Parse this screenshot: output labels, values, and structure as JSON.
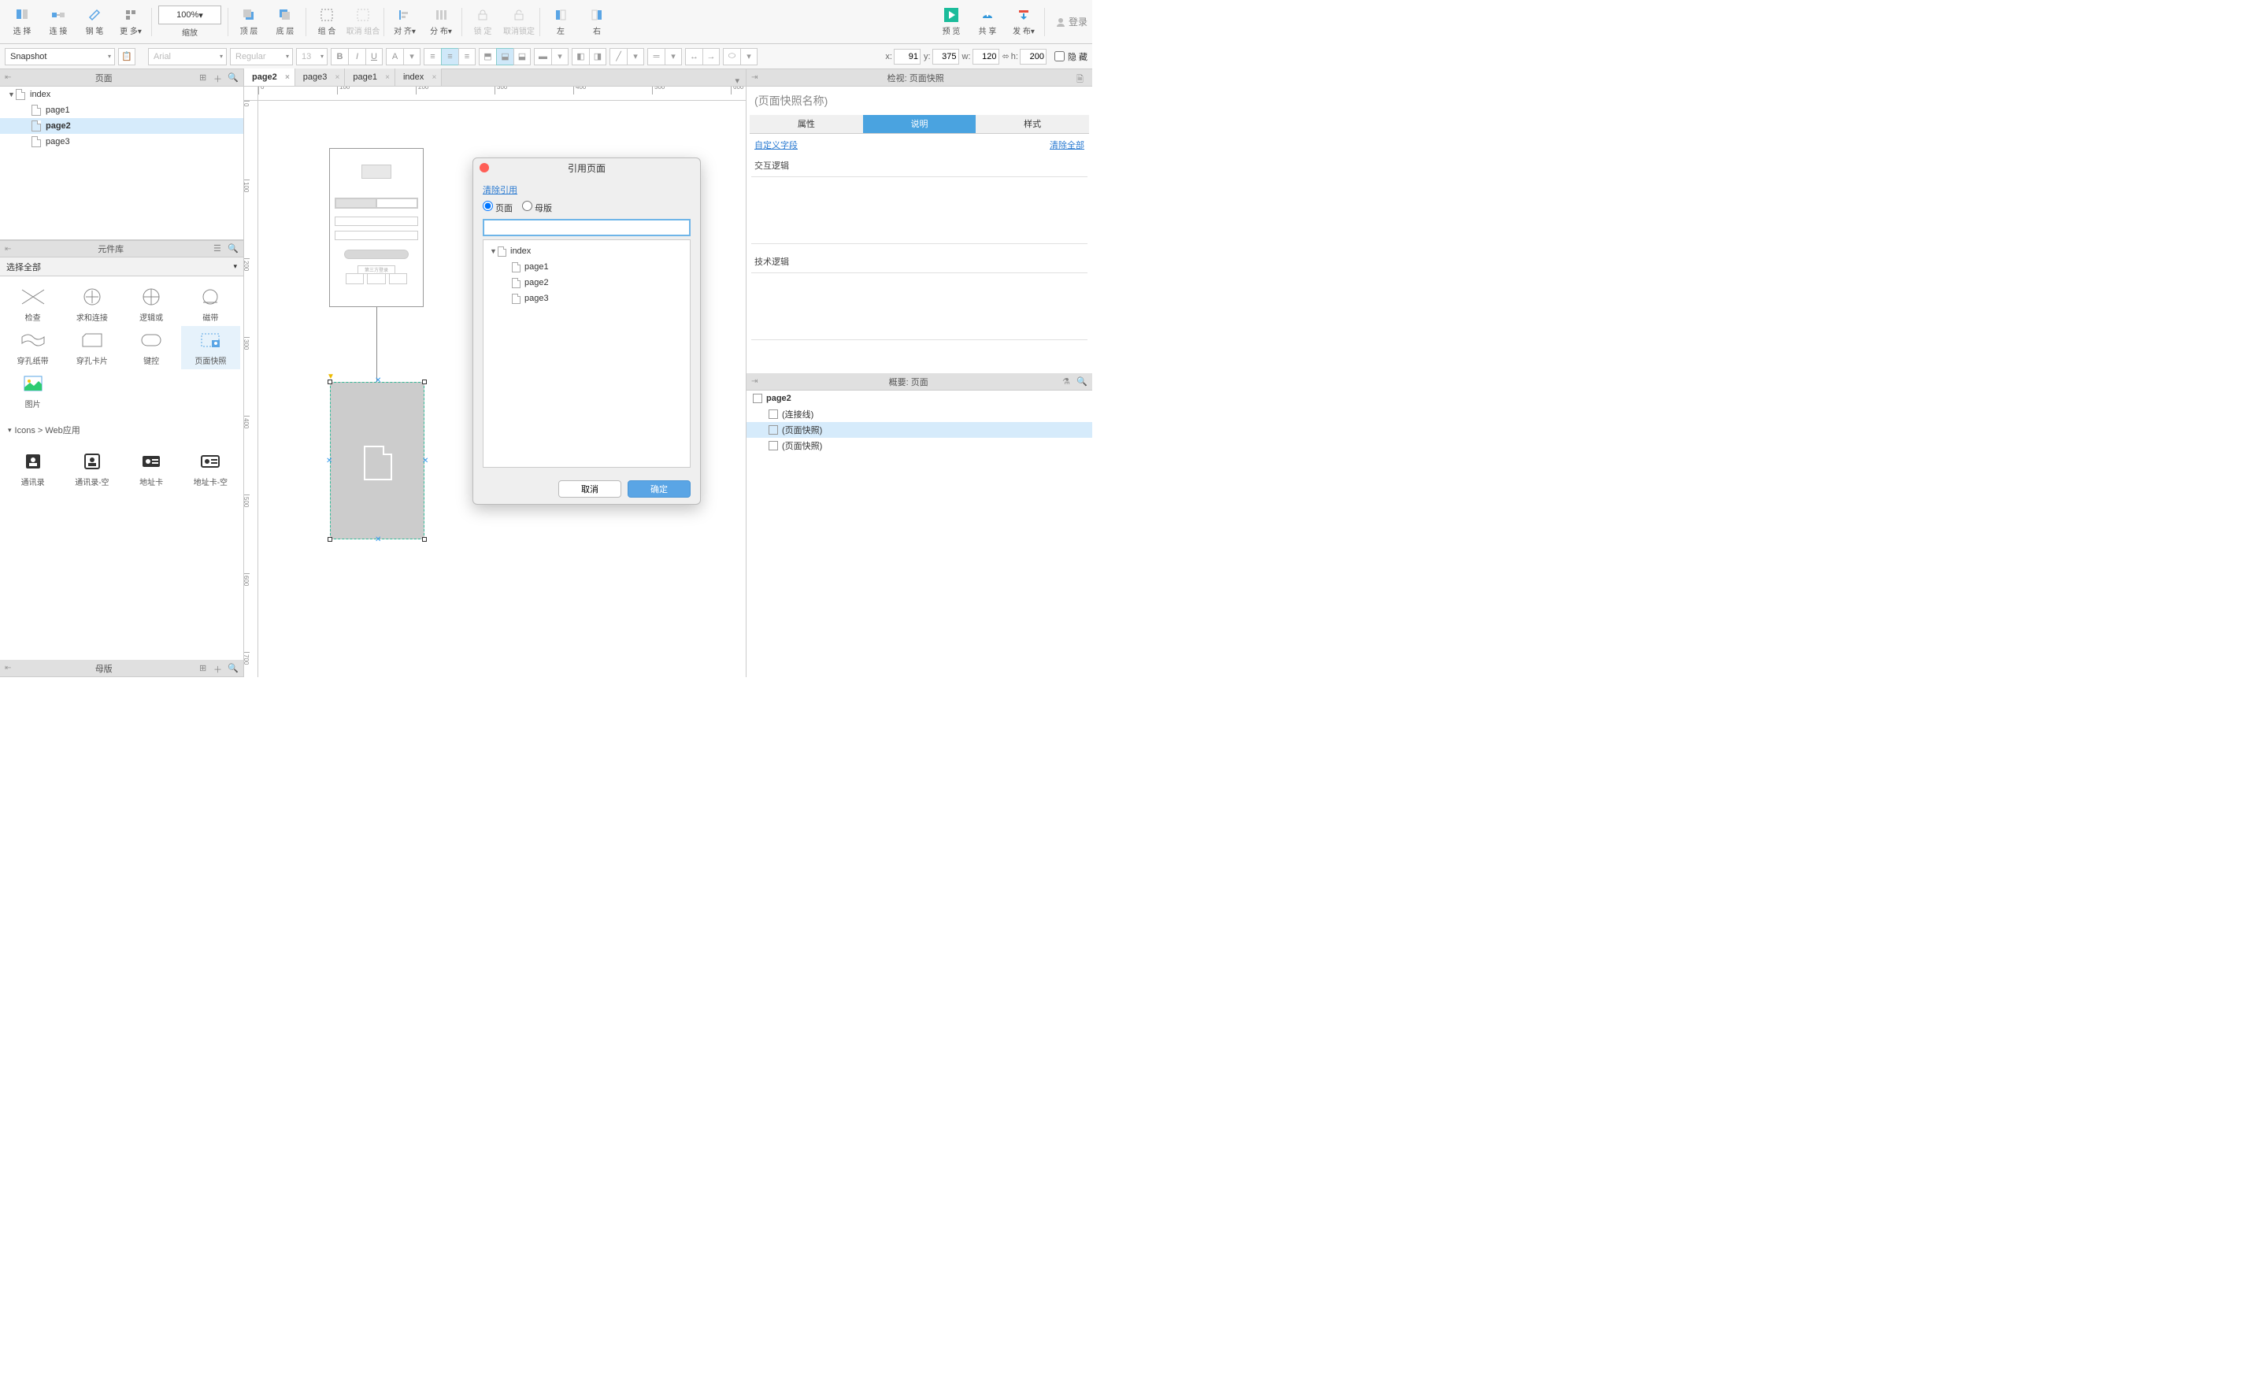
{
  "toolbar": {
    "select": "选 择",
    "connect": "连 接",
    "pen": "钢 笔",
    "more": "更 多",
    "zoom_label": "缩放",
    "zoom_value": "100%",
    "front": "顶 层",
    "back": "底 层",
    "group": "组 合",
    "ungroup": "取消 组合",
    "align": "对 齐",
    "distribute": "分 布",
    "lock": "锁 定",
    "unlock": "取消锁定",
    "left": "左",
    "right": "右",
    "preview": "预 览",
    "share": "共 享",
    "publish": "发 布",
    "login": "登录"
  },
  "fmt": {
    "style_dd": "Snapshot",
    "font": "Arial",
    "weight": "Regular",
    "size": "13",
    "x_lbl": "x:",
    "x": "91",
    "y_lbl": "y:",
    "y": "375",
    "w_lbl": "w:",
    "w": "120",
    "h_lbl": "h:",
    "h": "200",
    "hidden": "隐 藏"
  },
  "panels": {
    "pages": "页面",
    "widgets": "元件库",
    "masters": "母版",
    "inspector": "检视: 页面快照",
    "outline": "概要: 页面"
  },
  "pages_tree": {
    "root": "index",
    "children": [
      "page1",
      "page2",
      "page3"
    ],
    "selected": "page2"
  },
  "widget_filter": "选择全部",
  "widget_grid": [
    {
      "label": "检查"
    },
    {
      "label": "求和连接"
    },
    {
      "label": "逻辑或"
    },
    {
      "label": "磁带"
    },
    {
      "label": "穿孔纸带"
    },
    {
      "label": "穿孔卡片"
    },
    {
      "label": "键控"
    },
    {
      "label": "页面快照"
    },
    {
      "label": "图片"
    }
  ],
  "widget_category": "Icons > Web应用",
  "widget_grid2": [
    {
      "label": "通讯录"
    },
    {
      "label": "通讯录-空"
    },
    {
      "label": "地址卡"
    },
    {
      "label": "地址卡-空"
    }
  ],
  "tabs": [
    {
      "label": "page2",
      "active": true
    },
    {
      "label": "page3"
    },
    {
      "label": "page1"
    },
    {
      "label": "index"
    }
  ],
  "ruler_h": [
    "0",
    "100",
    "200",
    "300",
    "400",
    "500",
    "600"
  ],
  "ruler_v": [
    "0",
    "100",
    "200",
    "300",
    "400",
    "500",
    "600",
    "700"
  ],
  "wire_text": "第三方登录",
  "inspector": {
    "name_placeholder": "(页面快照名称)",
    "tabs": [
      "属性",
      "说明",
      "样式"
    ],
    "active_tab": "说明",
    "custom_fields": "自定义字段",
    "clear_all": "清除全部",
    "sec1": "交互逻辑",
    "sec2": "技术逻辑"
  },
  "outline_rows": [
    {
      "label": "page2",
      "depth": 0,
      "bold": true,
      "icon": "page"
    },
    {
      "label": "(连接线)",
      "depth": 1,
      "icon": "connector"
    },
    {
      "label": "(页面快照)",
      "depth": 1,
      "icon": "snapshot",
      "selected": true
    },
    {
      "label": "(页面快照)",
      "depth": 1,
      "icon": "snapshot"
    }
  ],
  "dialog": {
    "title": "引用页面",
    "clear": "清除引用",
    "radio_page": "页面",
    "radio_master": "母版",
    "tree_root": "index",
    "tree_children": [
      "page1",
      "page2",
      "page3"
    ],
    "cancel": "取消",
    "ok": "确定"
  }
}
